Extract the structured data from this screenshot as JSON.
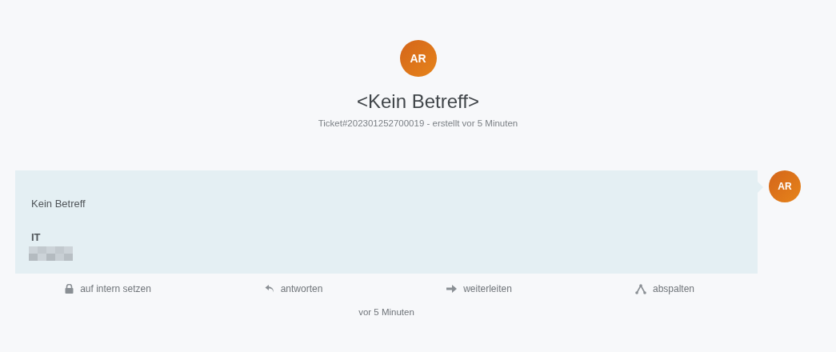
{
  "header": {
    "avatar": "AR",
    "title": "<Kein Betreff>",
    "subtitle": "Ticket#202301252700019 - erstellt vor 5 Minuten"
  },
  "article": {
    "avatar": "AR",
    "subject": "Kein Betreff",
    "signature": "IT",
    "actions": [
      {
        "kind": "lock",
        "label": "auf intern setzen"
      },
      {
        "kind": "reply",
        "label": "antworten"
      },
      {
        "kind": "forward",
        "label": "weiterleiten"
      },
      {
        "kind": "split",
        "label": "abspalten"
      }
    ],
    "time": "vor 5 Minuten"
  }
}
